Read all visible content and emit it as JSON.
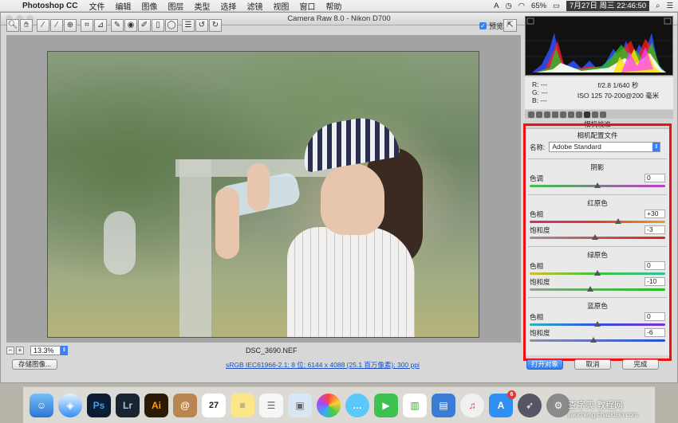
{
  "menubar": {
    "app_name": "Photoshop CC",
    "menus": [
      "文件",
      "编辑",
      "图像",
      "图层",
      "类型",
      "选择",
      "滤镜",
      "视图",
      "窗口",
      "帮助"
    ],
    "battery": "65%",
    "datetime": "7月27日 周三  22:46:50"
  },
  "window": {
    "title": "Camera Raw 8.0  -  Nikon D700",
    "preview_label": "预览",
    "zoom_value": "13.3%",
    "filename": "DSC_3690.NEF",
    "workflow_link": "sRGB IEC61966-2.1; 8 位; 6144 x 4088 (25.1 百万像素); 300 ppi",
    "buttons": {
      "save": "存储图像...",
      "open": "打开对象",
      "cancel": "取消",
      "done": "完成"
    }
  },
  "readout": {
    "r": "R:  ---",
    "g": "G:  ---",
    "b": "B:  ---",
    "aperture_shutter": "f/2.8    1/640 秒",
    "iso_lens": "ISO 125    70-200@200 毫米"
  },
  "panel": {
    "title": "相机校准",
    "profile_heading": "相机配置文件",
    "name_label": "名称:",
    "name_value": "Adobe Standard",
    "shadows": {
      "heading": "阴影",
      "tint_label": "色调",
      "tint_value": "0",
      "tint_level": 0.5
    },
    "red": {
      "heading": "红原色",
      "hue_label": "色相",
      "hue_value": "+30",
      "hue_level": 0.65,
      "sat_label": "饱和度",
      "sat_value": "-3",
      "sat_level": 0.485
    },
    "green": {
      "heading": "绿原色",
      "hue_label": "色相",
      "hue_value": "0",
      "hue_level": 0.5,
      "sat_label": "饱和度",
      "sat_value": "-10",
      "sat_level": 0.45
    },
    "blue": {
      "heading": "蓝原色",
      "hue_label": "色相",
      "hue_value": "0",
      "hue_level": 0.5,
      "sat_label": "饱和度",
      "sat_value": "-6",
      "sat_level": 0.47
    }
  },
  "dock": {
    "apps": [
      "finder-icon",
      "safari-icon",
      "photoshop-icon",
      "lightroom-icon",
      "illustrator-icon",
      "contacts-icon",
      "calendar-icon",
      "notes-icon",
      "reminders-icon",
      "preview-icon",
      "photos-icon",
      "messages-icon",
      "facetime-icon",
      "numbers-icon",
      "keynote-icon",
      "itunes-icon",
      "app-store-icon",
      "launchpad-icon",
      "system-preferences-icon"
    ],
    "calendar_day": "27",
    "app_store_badge": "6"
  },
  "watermark": {
    "line1": "查字典 教程网",
    "line2": "jiaocheng.chazidian.com"
  },
  "colors": {
    "accent": "#3b7ff5",
    "highlight_box": "#e11111"
  }
}
